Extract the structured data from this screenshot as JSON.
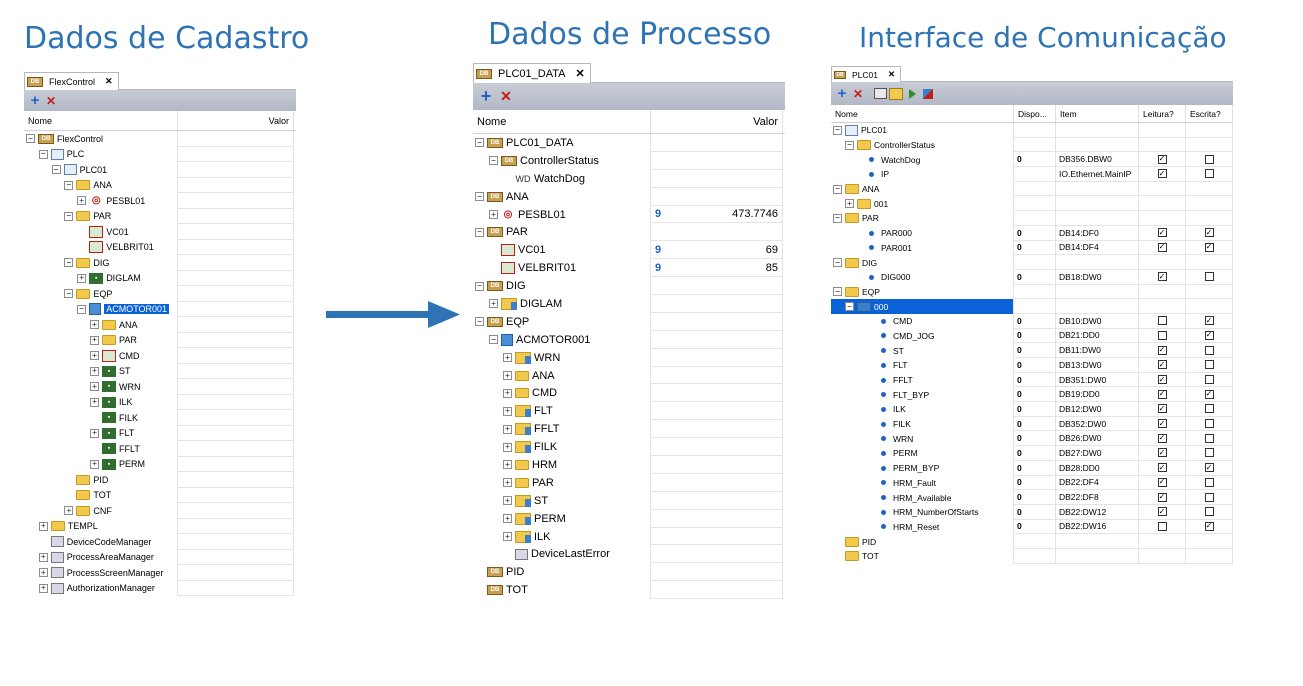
{
  "headings": {
    "cadastro": "Dados de Cadastro",
    "processo": "Dados de Processo",
    "interface": "Interface de Comunicação"
  },
  "icons": {
    "add": "+",
    "delete": "✕",
    "close": "✕",
    "checked": "✓",
    "expanded": "−",
    "collapsed": "+"
  },
  "cadastro": {
    "tab": "FlexControl",
    "columns": {
      "name": "Nome",
      "value": "Valor"
    },
    "rows": [
      {
        "label": "FlexControl",
        "level": 0,
        "exp": "-",
        "icon": "db"
      },
      {
        "label": "PLC",
        "level": 1,
        "exp": "-",
        "icon": "plc"
      },
      {
        "label": "PLC01",
        "level": 2,
        "exp": "-",
        "icon": "plc"
      },
      {
        "label": "ANA",
        "level": 3,
        "exp": "-",
        "icon": "folder"
      },
      {
        "label": "PESBL01",
        "level": 4,
        "exp": "+",
        "icon": "red"
      },
      {
        "label": "PAR",
        "level": 3,
        "exp": "-",
        "icon": "folder"
      },
      {
        "label": "VC01",
        "level": 4,
        "exp": "",
        "icon": "vc"
      },
      {
        "label": "VELBRIT01",
        "level": 4,
        "exp": "",
        "icon": "vc"
      },
      {
        "label": "DIG",
        "level": 3,
        "exp": "-",
        "icon": "folder"
      },
      {
        "label": "DIGLAM",
        "level": 4,
        "exp": "+",
        "icon": "tag"
      },
      {
        "label": "EQP",
        "level": 3,
        "exp": "-",
        "icon": "folder"
      },
      {
        "label": "ACMOTOR001",
        "level": 4,
        "exp": "-",
        "icon": "cube",
        "selected": true
      },
      {
        "label": "ANA",
        "level": 5,
        "exp": "+",
        "icon": "folder"
      },
      {
        "label": "PAR",
        "level": 5,
        "exp": "+",
        "icon": "folder"
      },
      {
        "label": "CMD",
        "level": 5,
        "exp": "+",
        "icon": "vc"
      },
      {
        "label": "ST",
        "level": 5,
        "exp": "+",
        "icon": "tag"
      },
      {
        "label": "WRN",
        "level": 5,
        "exp": "+",
        "icon": "tag"
      },
      {
        "label": "ILK",
        "level": 5,
        "exp": "+",
        "icon": "tag"
      },
      {
        "label": "FILK",
        "level": 5,
        "exp": "",
        "icon": "tag"
      },
      {
        "label": "FLT",
        "level": 5,
        "exp": "+",
        "icon": "tag"
      },
      {
        "label": "FFLT",
        "level": 5,
        "exp": "",
        "icon": "tag"
      },
      {
        "label": "PERM",
        "level": 5,
        "exp": "+",
        "icon": "tag"
      },
      {
        "label": "PID",
        "level": 3,
        "exp": "",
        "icon": "folder"
      },
      {
        "label": "TOT",
        "level": 3,
        "exp": "",
        "icon": "folder"
      },
      {
        "label": "CNF",
        "level": 3,
        "exp": "+",
        "icon": "folder"
      },
      {
        "label": "TEMPL",
        "level": 1,
        "exp": "+",
        "icon": "folder"
      },
      {
        "label": "DeviceCodeManager",
        "level": 1,
        "exp": "",
        "icon": "gen"
      },
      {
        "label": "ProcessAreaManager",
        "level": 1,
        "exp": "+",
        "icon": "gen"
      },
      {
        "label": "ProcessScreenManager",
        "level": 1,
        "exp": "+",
        "icon": "gen"
      },
      {
        "label": "AuthorizationManager",
        "level": 1,
        "exp": "+",
        "icon": "gen"
      }
    ]
  },
  "processo": {
    "tab": "PLC01_DATA",
    "columns": {
      "name": "Nome",
      "value": "Valor"
    },
    "rows": [
      {
        "label": "PLC01_DATA",
        "level": 0,
        "exp": "-",
        "icon": "db"
      },
      {
        "label": "ControllerStatus",
        "level": 1,
        "exp": "-",
        "icon": "db"
      },
      {
        "label": "WatchDog",
        "level": 2,
        "exp": "",
        "icon": "wd"
      },
      {
        "label": "ANA",
        "level": 0,
        "exp": "-",
        "icon": "db"
      },
      {
        "label": "PESBL01",
        "level": 1,
        "exp": "+",
        "icon": "red",
        "badge": "9",
        "value": "473.7746"
      },
      {
        "label": "PAR",
        "level": 0,
        "exp": "-",
        "icon": "db"
      },
      {
        "label": "VC01",
        "level": 1,
        "exp": "",
        "icon": "vc",
        "badge": "9",
        "value": "69"
      },
      {
        "label": "VELBRIT01",
        "level": 1,
        "exp": "",
        "icon": "vc",
        "badge": "9",
        "value": "85"
      },
      {
        "label": "DIG",
        "level": 0,
        "exp": "-",
        "icon": "db"
      },
      {
        "label": "DIGLAM",
        "level": 1,
        "exp": "+",
        "icon": "mixed"
      },
      {
        "label": "EQP",
        "level": 0,
        "exp": "-",
        "icon": "db"
      },
      {
        "label": "ACMOTOR001",
        "level": 1,
        "exp": "-",
        "icon": "cube"
      },
      {
        "label": "WRN",
        "level": 2,
        "exp": "+",
        "icon": "mixed"
      },
      {
        "label": "ANA",
        "level": 2,
        "exp": "+",
        "icon": "folder"
      },
      {
        "label": "CMD",
        "level": 2,
        "exp": "+",
        "icon": "folder"
      },
      {
        "label": "FLT",
        "level": 2,
        "exp": "+",
        "icon": "mixed"
      },
      {
        "label": "FFLT",
        "level": 2,
        "exp": "+",
        "icon": "mixed"
      },
      {
        "label": "FILK",
        "level": 2,
        "exp": "+",
        "icon": "mixed"
      },
      {
        "label": "HRM",
        "level": 2,
        "exp": "+",
        "icon": "folder"
      },
      {
        "label": "PAR",
        "level": 2,
        "exp": "+",
        "icon": "folder"
      },
      {
        "label": "ST",
        "level": 2,
        "exp": "+",
        "icon": "mixed"
      },
      {
        "label": "PERM",
        "level": 2,
        "exp": "+",
        "icon": "mixed"
      },
      {
        "label": "ILK",
        "level": 2,
        "exp": "+",
        "icon": "mixed"
      },
      {
        "label": "DeviceLastError",
        "level": 2,
        "exp": "",
        "icon": "gen"
      },
      {
        "label": "PID",
        "level": 0,
        "exp": "",
        "icon": "db"
      },
      {
        "label": "TOT",
        "level": 0,
        "exp": "",
        "icon": "db"
      }
    ]
  },
  "interface": {
    "tab": "PLC01",
    "columns": {
      "name": "Nome",
      "dispo": "Dispo...",
      "item": "Item",
      "leitura": "Leitura?",
      "escrita": "Escrita?"
    },
    "rows": [
      {
        "label": "PLC01",
        "level": 0,
        "exp": "-",
        "icon": "plc"
      },
      {
        "label": "ControllerStatus",
        "level": 1,
        "exp": "-",
        "icon": "folder"
      },
      {
        "label": "WatchDog",
        "level": 2,
        "exp": "",
        "icon": "dot",
        "dispo": "0",
        "item": "DB356.DBW0",
        "read": true,
        "write": false
      },
      {
        "label": "IP",
        "level": 2,
        "exp": "",
        "icon": "dot",
        "dispo": "",
        "item": "IO.Ethernet.MainIP",
        "read": true,
        "write": false
      },
      {
        "label": "ANA",
        "level": 0,
        "exp": "-",
        "icon": "folder"
      },
      {
        "label": "001",
        "level": 1,
        "exp": "+",
        "icon": "folder"
      },
      {
        "label": "PAR",
        "level": 0,
        "exp": "-",
        "icon": "folder"
      },
      {
        "label": "PAR000",
        "level": 2,
        "exp": "",
        "icon": "dot",
        "dispo": "0",
        "item": "DB14:DF0",
        "read": true,
        "write": true
      },
      {
        "label": "PAR001",
        "level": 2,
        "exp": "",
        "icon": "dot",
        "dispo": "0",
        "item": "DB14:DF4",
        "read": true,
        "write": true
      },
      {
        "label": "DIG",
        "level": 0,
        "exp": "-",
        "icon": "folder"
      },
      {
        "label": "DIG000",
        "level": 2,
        "exp": "",
        "icon": "dot",
        "dispo": "0",
        "item": "DB18:DW0",
        "read": true,
        "write": false
      },
      {
        "label": "EQP",
        "level": 0,
        "exp": "-",
        "icon": "folder"
      },
      {
        "label": "000",
        "level": 1,
        "exp": "-",
        "icon": "folderblue",
        "selected": true
      },
      {
        "label": "CMD",
        "level": 3,
        "exp": "",
        "icon": "dot",
        "dispo": "0",
        "item": "DB10:DW0",
        "read": false,
        "write": true
      },
      {
        "label": "CMD_JOG",
        "level": 3,
        "exp": "",
        "icon": "dot",
        "dispo": "0",
        "item": "DB21:DD0",
        "read": false,
        "write": true
      },
      {
        "label": "ST",
        "level": 3,
        "exp": "",
        "icon": "dot",
        "dispo": "0",
        "item": "DB11:DW0",
        "read": true,
        "write": false
      },
      {
        "label": "FLT",
        "level": 3,
        "exp": "",
        "icon": "dot",
        "dispo": "0",
        "item": "DB13:DW0",
        "read": true,
        "write": false
      },
      {
        "label": "FFLT",
        "level": 3,
        "exp": "",
        "icon": "dot",
        "dispo": "0",
        "item": "DB351:DW0",
        "read": true,
        "write": false
      },
      {
        "label": "FLT_BYP",
        "level": 3,
        "exp": "",
        "icon": "dot",
        "dispo": "0",
        "item": "DB19:DD0",
        "read": true,
        "write": true
      },
      {
        "label": "ILK",
        "level": 3,
        "exp": "",
        "icon": "dot",
        "dispo": "0",
        "item": "DB12:DW0",
        "read": true,
        "write": false
      },
      {
        "label": "FILK",
        "level": 3,
        "exp": "",
        "icon": "dot",
        "dispo": "0",
        "item": "DB352:DW0",
        "read": true,
        "write": false
      },
      {
        "label": "WRN",
        "level": 3,
        "exp": "",
        "icon": "dot",
        "dispo": "0",
        "item": "DB26:DW0",
        "read": true,
        "write": false
      },
      {
        "label": "PERM",
        "level": 3,
        "exp": "",
        "icon": "dot",
        "dispo": "0",
        "item": "DB27:DW0",
        "read": true,
        "write": false
      },
      {
        "label": "PERM_BYP",
        "level": 3,
        "exp": "",
        "icon": "dot",
        "dispo": "0",
        "item": "DB28:DD0",
        "read": true,
        "write": true
      },
      {
        "label": "HRM_Fault",
        "level": 3,
        "exp": "",
        "icon": "dot",
        "dispo": "0",
        "item": "DB22:DF4",
        "read": true,
        "write": false
      },
      {
        "label": "HRM_Available",
        "level": 3,
        "exp": "",
        "icon": "dot",
        "dispo": "0",
        "item": "DB22:DF8",
        "read": true,
        "write": false
      },
      {
        "label": "HRM_NumberOfStarts",
        "level": 3,
        "exp": "",
        "icon": "dot",
        "dispo": "0",
        "item": "DB22:DW12",
        "read": true,
        "write": false
      },
      {
        "label": "HRM_Reset",
        "level": 3,
        "exp": "",
        "icon": "dot",
        "dispo": "0",
        "item": "DB22:DW16",
        "read": false,
        "write": true
      },
      {
        "label": "PID",
        "level": 0,
        "exp": "",
        "icon": "folder"
      },
      {
        "label": "TOT",
        "level": 0,
        "exp": "",
        "icon": "folder"
      }
    ]
  },
  "colors": {
    "heading": "#2e74b5",
    "arrow": "#2e74b5",
    "selection": "#0a62d6",
    "toolbar": "#b8bdca"
  }
}
